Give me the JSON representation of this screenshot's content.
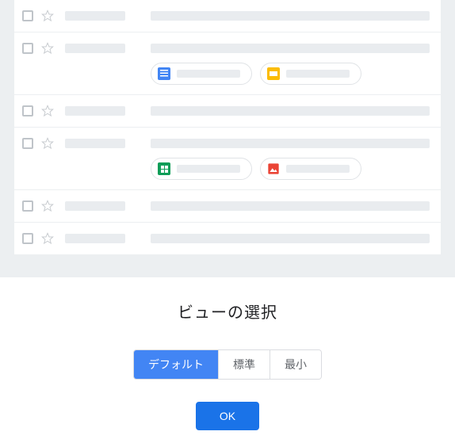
{
  "dialog": {
    "title": "ビューの選択",
    "options": {
      "default": "デフォルト",
      "standard": "標準",
      "compact": "最小"
    },
    "ok": "OK"
  },
  "icons": {
    "docs": "docs-icon",
    "slides": "slides-icon",
    "sheets": "sheets-icon",
    "image": "image-icon"
  }
}
